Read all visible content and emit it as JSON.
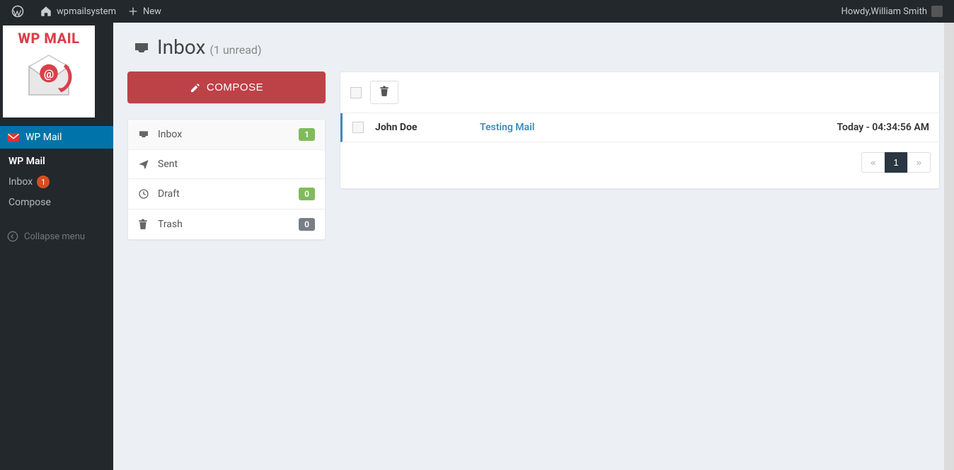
{
  "adminbar": {
    "site_name": "wpmailsystem",
    "new_label": "New",
    "howdy_prefix": "Howdy, ",
    "user_name": "William Smith"
  },
  "sidebar": {
    "logo_text": "WP MAIL",
    "top_item": "WP Mail",
    "submenu": [
      {
        "label": "WP Mail"
      },
      {
        "label": "Inbox",
        "badge": "1"
      },
      {
        "label": "Compose"
      }
    ],
    "collapse_label": "Collapse menu"
  },
  "header": {
    "title": "Inbox",
    "subtitle": "(1 unread)"
  },
  "compose_button": "COMPOSE",
  "folders": [
    {
      "icon": "inbox",
      "label": "Inbox",
      "count": "1",
      "count_style": "green"
    },
    {
      "icon": "send",
      "label": "Sent"
    },
    {
      "icon": "clock",
      "label": "Draft",
      "count": "0",
      "count_style": "green"
    },
    {
      "icon": "trash",
      "label": "Trash",
      "count": "0",
      "count_style": "gray"
    }
  ],
  "messages": [
    {
      "sender": "John Doe",
      "subject": "Testing Mail",
      "time": "Today - 04:34:56 AM"
    }
  ],
  "pagination": {
    "prev": "«",
    "pages": [
      "1"
    ],
    "next": "»"
  }
}
